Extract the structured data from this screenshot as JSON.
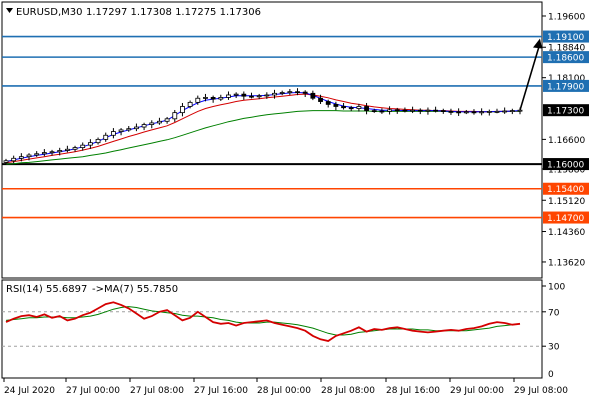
{
  "header": {
    "symbol_timeframe": "EURUSD,M30",
    "ohlc": "1.17297 1.17308 1.17275 1.17306"
  },
  "rsi_header": {
    "label": "RSI(14) 55.6897",
    "ma_label": "->MA(7) 55.7850"
  },
  "colors": {
    "background": "#ffffff",
    "candle": "#000000",
    "ma_fast": "#0000ff",
    "ma_mid": "#d40000",
    "ma_slow": "#008000",
    "resistance": "#1f6fb2",
    "support_major": "#000000",
    "support": "#ff4500",
    "rsi_line": "#d40000",
    "rsi_ma": "#008000",
    "arrow": "#000000"
  },
  "chart_data": [
    {
      "type": "candlestick",
      "title": "EURUSD,M30",
      "x_tick_labels": [
        "24 Jul 2020",
        "27 Jul 00:00",
        "27 Jul 08:00",
        "27 Jul 16:00",
        "28 Jul 00:00",
        "28 Jul 08:00",
        "28 Jul 16:00",
        "29 Jul 00:00",
        "29 Jul 08:00"
      ],
      "y_tick_labels": [
        "1.19600",
        "1.18840",
        "1.18100",
        "1.16600",
        "1.15880",
        "1.15120",
        "1.14360",
        "1.13620"
      ],
      "ylim": [
        1.1323,
        1.1994
      ],
      "price_levels": [
        {
          "label": "1.19100",
          "value": 1.191,
          "role": "resistance"
        },
        {
          "label": "1.18600",
          "value": 1.186,
          "role": "resistance"
        },
        {
          "label": "1.17900",
          "value": 1.179,
          "role": "resistance"
        },
        {
          "label": "1.17300",
          "value": 1.1731,
          "role": "current"
        },
        {
          "label": "1.16000",
          "value": 1.16,
          "role": "support_major"
        },
        {
          "label": "1.15400",
          "value": 1.154,
          "role": "support"
        },
        {
          "label": "1.14700",
          "value": 1.147,
          "role": "support"
        }
      ],
      "close": [
        1.1608,
        1.1614,
        1.1618,
        1.1622,
        1.1625,
        1.1628,
        1.163,
        1.1633,
        1.1636,
        1.164,
        1.1646,
        1.1652,
        1.166,
        1.167,
        1.1679,
        1.1683,
        1.1686,
        1.169,
        1.1696,
        1.17,
        1.1704,
        1.171,
        1.1725,
        1.174,
        1.175,
        1.176,
        1.1762,
        1.1758,
        1.1762,
        1.1768,
        1.177,
        1.1765,
        1.1764,
        1.1766,
        1.1768,
        1.1772,
        1.1774,
        1.1776,
        1.1775,
        1.1772,
        1.176,
        1.1752,
        1.1745,
        1.174,
        1.1737,
        1.1735,
        1.174,
        1.173,
        1.1729,
        1.1728,
        1.1732,
        1.1731,
        1.173,
        1.1731,
        1.1729,
        1.1731,
        1.173,
        1.1728,
        1.1727,
        1.1726,
        1.1727,
        1.1726,
        1.1727,
        1.1728,
        1.1728,
        1.1729,
        1.173,
        1.1731
      ],
      "open": [
        1.1604,
        1.1608,
        1.1614,
        1.1618,
        1.1622,
        1.1625,
        1.1628,
        1.163,
        1.1633,
        1.1636,
        1.164,
        1.1646,
        1.1652,
        1.166,
        1.167,
        1.1679,
        1.1683,
        1.1686,
        1.169,
        1.1696,
        1.17,
        1.1704,
        1.171,
        1.1725,
        1.174,
        1.175,
        1.176,
        1.1762,
        1.1758,
        1.1762,
        1.1768,
        1.177,
        1.1765,
        1.1764,
        1.1766,
        1.1768,
        1.1772,
        1.1774,
        1.1776,
        1.1775,
        1.1772,
        1.176,
        1.1752,
        1.1745,
        1.174,
        1.1737,
        1.1735,
        1.174,
        1.173,
        1.1729,
        1.1728,
        1.1732,
        1.1731,
        1.173,
        1.1731,
        1.1729,
        1.1731,
        1.173,
        1.1728,
        1.1727,
        1.1726,
        1.1727,
        1.1726,
        1.1727,
        1.1728,
        1.1728,
        1.1729,
        1.173
      ],
      "ma_fast": [
        1.1606,
        1.161,
        1.1614,
        1.1618,
        1.1621,
        1.1624,
        1.1627,
        1.163,
        1.1633,
        1.1637,
        1.1642,
        1.1648,
        1.1655,
        1.1664,
        1.1672,
        1.1678,
        1.1683,
        1.1688,
        1.1693,
        1.1698,
        1.1702,
        1.1707,
        1.1718,
        1.173,
        1.174,
        1.1749,
        1.1755,
        1.1758,
        1.176,
        1.1763,
        1.1766,
        1.1766,
        1.1766,
        1.1766,
        1.1767,
        1.1769,
        1.1771,
        1.1773,
        1.1774,
        1.1773,
        1.1767,
        1.176,
        1.1752,
        1.1746,
        1.1741,
        1.1738,
        1.1737,
        1.1735,
        1.1733,
        1.1731,
        1.1731,
        1.1731,
        1.173,
        1.173,
        1.173,
        1.173,
        1.173,
        1.1729,
        1.1728,
        1.1727,
        1.1727,
        1.1727,
        1.1727,
        1.1727,
        1.1728,
        1.1728,
        1.1729,
        1.173
      ],
      "ma_mid": [
        1.1603,
        1.1606,
        1.1609,
        1.1612,
        1.1615,
        1.1618,
        1.1621,
        1.1624,
        1.1627,
        1.163,
        1.1634,
        1.1638,
        1.1643,
        1.1649,
        1.1655,
        1.1661,
        1.1667,
        1.1672,
        1.1678,
        1.1683,
        1.1688,
        1.1693,
        1.1701,
        1.171,
        1.1719,
        1.1728,
        1.1735,
        1.174,
        1.1744,
        1.1748,
        1.1752,
        1.1755,
        1.1757,
        1.1759,
        1.1761,
        1.1763,
        1.1765,
        1.1767,
        1.1769,
        1.177,
        1.1768,
        1.1765,
        1.1761,
        1.1756,
        1.1752,
        1.1748,
        1.1745,
        1.1742,
        1.1739,
        1.1737,
        1.1735,
        1.1734,
        1.1733,
        1.1732,
        1.1731,
        1.1731,
        1.173,
        1.173,
        1.1729,
        1.1728,
        1.1728,
        1.1728,
        1.1727,
        1.1727,
        1.1728,
        1.1728,
        1.1729,
        1.1729
      ],
      "ma_slow": [
        1.16,
        1.1601,
        1.1603,
        1.1604,
        1.1606,
        1.1608,
        1.161,
        1.1612,
        1.1614,
        1.1616,
        1.1618,
        1.1621,
        1.1624,
        1.1627,
        1.1631,
        1.1635,
        1.1639,
        1.1643,
        1.1647,
        1.1651,
        1.1655,
        1.1659,
        1.1664,
        1.167,
        1.1676,
        1.1682,
        1.1688,
        1.1693,
        1.1698,
        1.1703,
        1.1707,
        1.1711,
        1.1714,
        1.1717,
        1.172,
        1.1722,
        1.1724,
        1.1726,
        1.1728,
        1.1729,
        1.173,
        1.173,
        1.173,
        1.173,
        1.1729,
        1.1729,
        1.1729,
        1.1729,
        1.1728,
        1.1728,
        1.1728,
        1.1728,
        1.1728,
        1.1728,
        1.1728,
        1.1728,
        1.1728,
        1.1728,
        1.1727,
        1.1727,
        1.1727,
        1.1727,
        1.1727,
        1.1727,
        1.1727,
        1.1728,
        1.1728,
        1.1728
      ],
      "projection": {
        "from": 1.1731,
        "to": 1.191
      }
    },
    {
      "type": "line",
      "title": "RSI(14) 55.6897",
      "y_tick_labels": [
        "100",
        "70",
        "30",
        "0"
      ],
      "ylim": [
        0,
        100
      ],
      "levels": [
        70,
        30
      ],
      "series": [
        {
          "name": "RSI(14)",
          "values": [
            58,
            62,
            65,
            66,
            64,
            67,
            63,
            65,
            60,
            62,
            66,
            69,
            74,
            79,
            81,
            78,
            74,
            68,
            62,
            65,
            70,
            72,
            66,
            60,
            63,
            70,
            64,
            58,
            56,
            57,
            54,
            57,
            58,
            59,
            60,
            57,
            55,
            53,
            51,
            48,
            42,
            38,
            36,
            42,
            45,
            48,
            52,
            47,
            50,
            49,
            51,
            52,
            50,
            48,
            47,
            46,
            47,
            48,
            49,
            48,
            50,
            51,
            53,
            56,
            58,
            57,
            55,
            56
          ]
        },
        {
          "name": "MA(7)",
          "values": [
            60,
            61,
            62,
            63,
            63,
            64,
            64,
            64,
            63,
            63,
            64,
            65,
            67,
            70,
            73,
            75,
            76,
            75,
            73,
            71,
            70,
            69,
            68,
            66,
            65,
            65,
            64,
            63,
            61,
            60,
            58,
            57,
            57,
            57,
            58,
            58,
            57,
            56,
            55,
            53,
            51,
            48,
            45,
            43,
            43,
            44,
            46,
            47,
            48,
            49,
            50,
            50,
            50,
            50,
            49,
            49,
            48,
            48,
            48,
            48,
            48,
            49,
            50,
            51,
            53,
            54,
            55,
            56
          ]
        }
      ]
    }
  ]
}
